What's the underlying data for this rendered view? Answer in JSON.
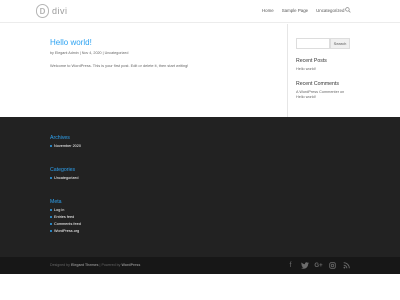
{
  "header": {
    "logo_text": "divi",
    "logo_mark": "D",
    "nav": [
      "Home",
      "Sample Page",
      "Uncategorized"
    ],
    "search_icon": "search-icon"
  },
  "post": {
    "title": "Hello world!",
    "meta": "by Elegant Admin | Nov 4, 2020 | Uncategorized",
    "body": "Welcome to WordPress. This is your first post. Edit or delete it, then start writing!"
  },
  "sidebar": {
    "search_button": "Search",
    "recent_posts_title": "Recent Posts",
    "recent_posts": [
      "Hello world!"
    ],
    "recent_comments_title": "Recent Comments",
    "recent_comments": "A WordPress Commenter on Hello world!"
  },
  "footer": {
    "archives_title": "Archives",
    "archives": [
      "November 2020"
    ],
    "categories_title": "Categories",
    "categories": [
      "Uncategorized"
    ],
    "meta_title": "Meta",
    "meta": [
      "Log in",
      "Entries feed",
      "Comments feed",
      "WordPress.org"
    ],
    "credits_prefix": "Designed by",
    "credits_designer": "Elegant Themes",
    "credits_sep": "| Powered by",
    "credits_platform": "WordPress",
    "social_icons": [
      "facebook-icon",
      "twitter-icon",
      "google-plus-icon",
      "instagram-icon",
      "rss-icon"
    ]
  },
  "colors": {
    "accent": "#2ea3f2",
    "footer_bg": "#222222",
    "bottom_bg": "#171717"
  }
}
